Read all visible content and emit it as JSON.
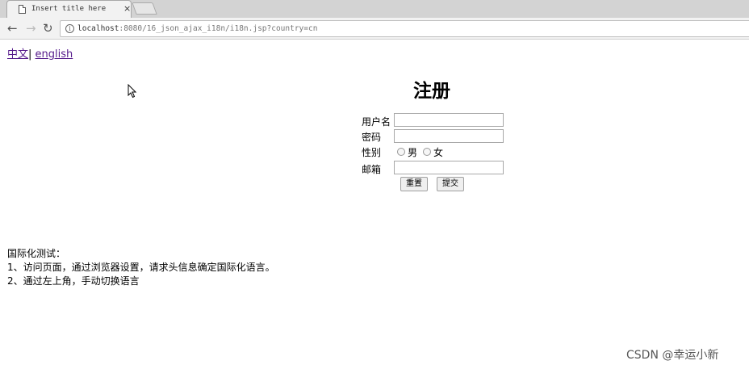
{
  "browser": {
    "tab_title": "Insert title here",
    "tab_close": "×",
    "url_host": "localhost",
    "url_rest": ":8080/16_json_ajax_i18n/i18n.jsp?country=cn",
    "icons": {
      "page": "page-icon",
      "back": "back-arrow-icon",
      "forward": "forward-arrow-icon",
      "reload": "reload-icon",
      "info": "info-icon"
    }
  },
  "page": {
    "lang_links": {
      "chinese": "中文",
      "separator": "|",
      "english": "english"
    },
    "form": {
      "title": "注册",
      "username_label": "用户名",
      "password_label": "密码",
      "gender_label": "性别",
      "gender_male": "男",
      "gender_female": "女",
      "email_label": "邮箱",
      "reset_button": "重置",
      "submit_button": "提交"
    },
    "notes": [
      "国际化测试：",
      "1、访问页面，通过浏览器设置，请求头信息确定国际化语言。",
      "2、通过左上角，手动切换语言"
    ]
  },
  "watermark": "CSDN @幸运小新"
}
